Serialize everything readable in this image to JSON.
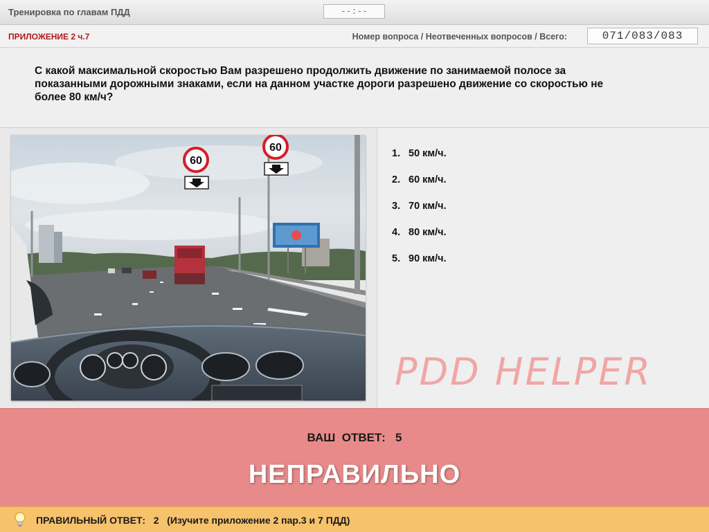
{
  "header": {
    "app_title": "Тренировка по главам ПДД",
    "timer": "--:--"
  },
  "infobar": {
    "section": "ПРИЛОЖЕНИЕ 2 ч.7",
    "counter_label": "Номер вопроса / Неотвеченных вопросов / Всего:",
    "counter_value": "071/083/083"
  },
  "question": {
    "text": "С какой максимальной скоростью Вам разрешено продолжить движение по занимаемой полосе за показанными дорожными знаками, если на данном участке дороги разрешено движение со скоростью не более 80 км/ч?"
  },
  "image": {
    "sign_left_speed": "60",
    "sign_right_speed": "60",
    "icons": [
      "speed-limit-sign",
      "lane-arrow-down-sign"
    ]
  },
  "answers": [
    {
      "num": "1.",
      "label": "50 км/ч."
    },
    {
      "num": "2.",
      "label": "60 км/ч."
    },
    {
      "num": "3.",
      "label": "70 км/ч."
    },
    {
      "num": "4.",
      "label": "80 км/ч."
    },
    {
      "num": "5.",
      "label": "90 км/ч."
    }
  ],
  "watermark": "PDD HELPER",
  "result": {
    "your_answer": "ВАШ  ОТВЕТ:   5",
    "verdict": "НЕПРАВИЛЬНО",
    "color": "#e98a8a"
  },
  "hint": {
    "icon": "lightbulb-icon",
    "text": "ПРАВИЛЬНЫЙ ОТВЕТ:   2   (Изучите приложение 2 пар.3 и 7 ПДД)",
    "color": "#f6c26c"
  }
}
